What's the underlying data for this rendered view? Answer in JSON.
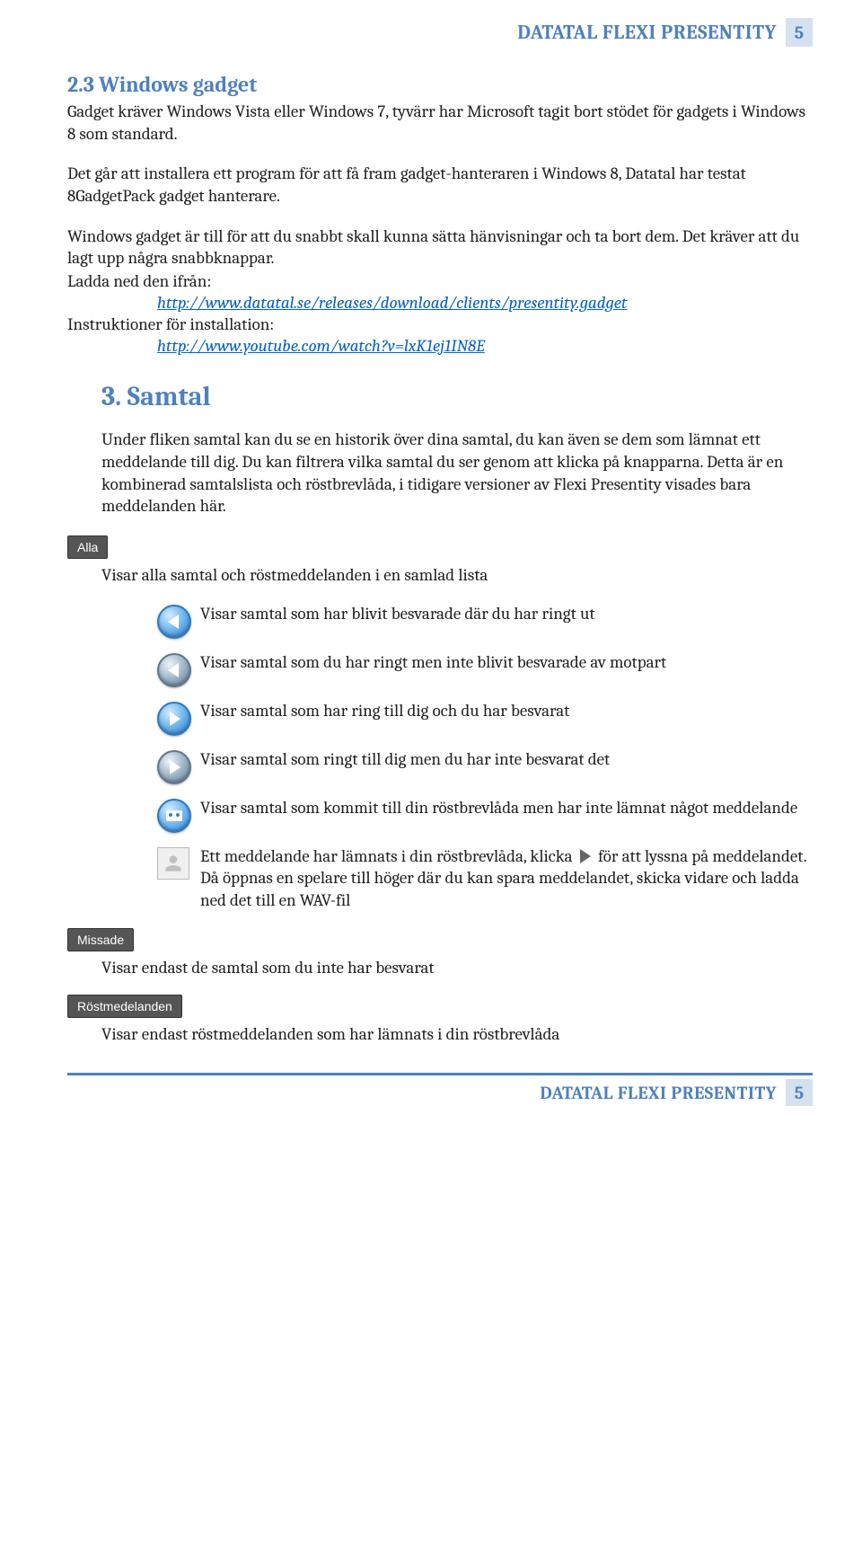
{
  "header": {
    "title": "DATATAL FLEXI PRESENTITY",
    "page": "5"
  },
  "section23": {
    "title": "2.3 Windows gadget",
    "p1": "Gadget kräver Windows Vista eller Windows 7, tyvärr har Microsoft tagit bort stödet för gadgets i Windows 8 som standard.",
    "p2": "Det går att installera ett program för att få fram gadget-hanteraren i Windows 8, Datatal har testat 8GadgetPack gadget hanterare.",
    "p3": "Windows gadget är till för att du snabbt skall kunna sätta hänvisningar och ta bort dem. Det kräver att du lagt upp några snabbknappar.",
    "download_label": "Ladda ned den ifrån:",
    "download_link": "http://www.datatal.se/releases/download/clients/presentity.gadget",
    "instr_label": "Instruktioner för installation:",
    "instr_link": "http://www.youtube.com/watch?v=lxK1ej1IN8E"
  },
  "section3": {
    "title": "3. Samtal",
    "intro": "Under fliken samtal kan du se en historik över dina samtal, du kan även se dem som lämnat ett meddelande till dig. Du kan filtrera vilka samtal du ser genom att klicka på knapparna. Detta är en kombinerad samtalslista och röstbrevlåda, i tidigare versioner av Flexi Presentity visades bara meddelanden här.",
    "alla_button": "Alla",
    "alla_text": "Visar alla samtal och röstmeddelanden i en samlad lista",
    "row_outgoing_answered": "Visar samtal som har blivit besvarade där du har ringt ut",
    "row_outgoing_unanswered": "Visar samtal som du har ringt men inte blivit besvarade av motpart",
    "row_incoming_answered": "Visar samtal som har ring till dig och du har besvarat",
    "row_incoming_unanswered": "Visar samtal som ringt till dig men du har inte besvarat det",
    "row_voicemail_nomsg": "Visar samtal som kommit till din röstbrevlåda men har inte lämnat något meddelande",
    "row_voicemail_msg_a": "Ett meddelande har lämnats i din röstbrevlåda, klicka ",
    "row_voicemail_msg_b": " för att lyssna på meddelandet. Då öppnas en spelare till höger där du kan spara meddelandet, skicka vidare och ladda ned det till en WAV-fil",
    "missade_button": "Missade",
    "missade_text": "Visar endast de samtal som du inte har besvarat",
    "rost_button": "Röstmedelanden",
    "rost_text": "Visar endast röstmeddelanden som har lämnats i din röstbrevlåda"
  },
  "footer": {
    "title": "DATATAL FLEXI PRESENTITY",
    "page": "5"
  }
}
